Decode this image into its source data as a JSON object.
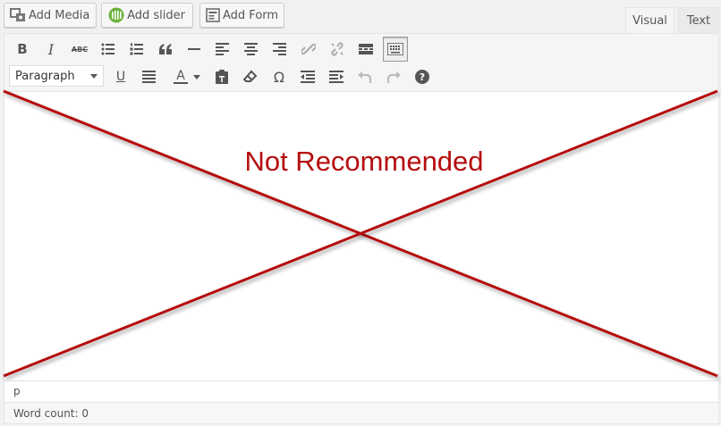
{
  "media_buttons": [
    {
      "label": "Add Media",
      "icon": "media-icon"
    },
    {
      "label": "Add slider",
      "icon": "slider-icon"
    },
    {
      "label": "Add Form",
      "icon": "form-icon"
    }
  ],
  "tabs": {
    "visual": "Visual",
    "text": "Text",
    "active": "visual"
  },
  "toolbar": {
    "row1_icons": [
      "bold-icon",
      "italic-icon",
      "strikethrough-icon",
      "bullet-list-icon",
      "numbered-list-icon",
      "blockquote-icon",
      "horizontal-rule-icon",
      "align-left-icon",
      "align-center-icon",
      "align-right-icon",
      "insert-link-icon",
      "unlink-icon",
      "read-more-icon",
      "toolbar-toggle-icon"
    ],
    "row2_icons": [
      "underline-icon",
      "justify-icon",
      "text-color-icon",
      "paste-text-icon",
      "clear-formatting-icon",
      "special-character-icon",
      "outdent-icon",
      "indent-icon",
      "undo-icon",
      "redo-icon",
      "help-icon"
    ],
    "bold_glyph": "B",
    "italic_glyph": "I",
    "strike_glyph": "ABC",
    "underline_glyph": "U",
    "color_glyph": "A",
    "omega_glyph": "Ω",
    "help_glyph": "?",
    "format_select": {
      "value": "Paragraph"
    }
  },
  "overlay": {
    "text": "Not Recommended",
    "color": "#b50e0e"
  },
  "status": {
    "path": "p",
    "word_count": "Word count: 0"
  },
  "colors": {
    "accent_green": "#6cb33f",
    "border": "#e5e5e5",
    "toolbar_bg": "#f5f5f5"
  }
}
